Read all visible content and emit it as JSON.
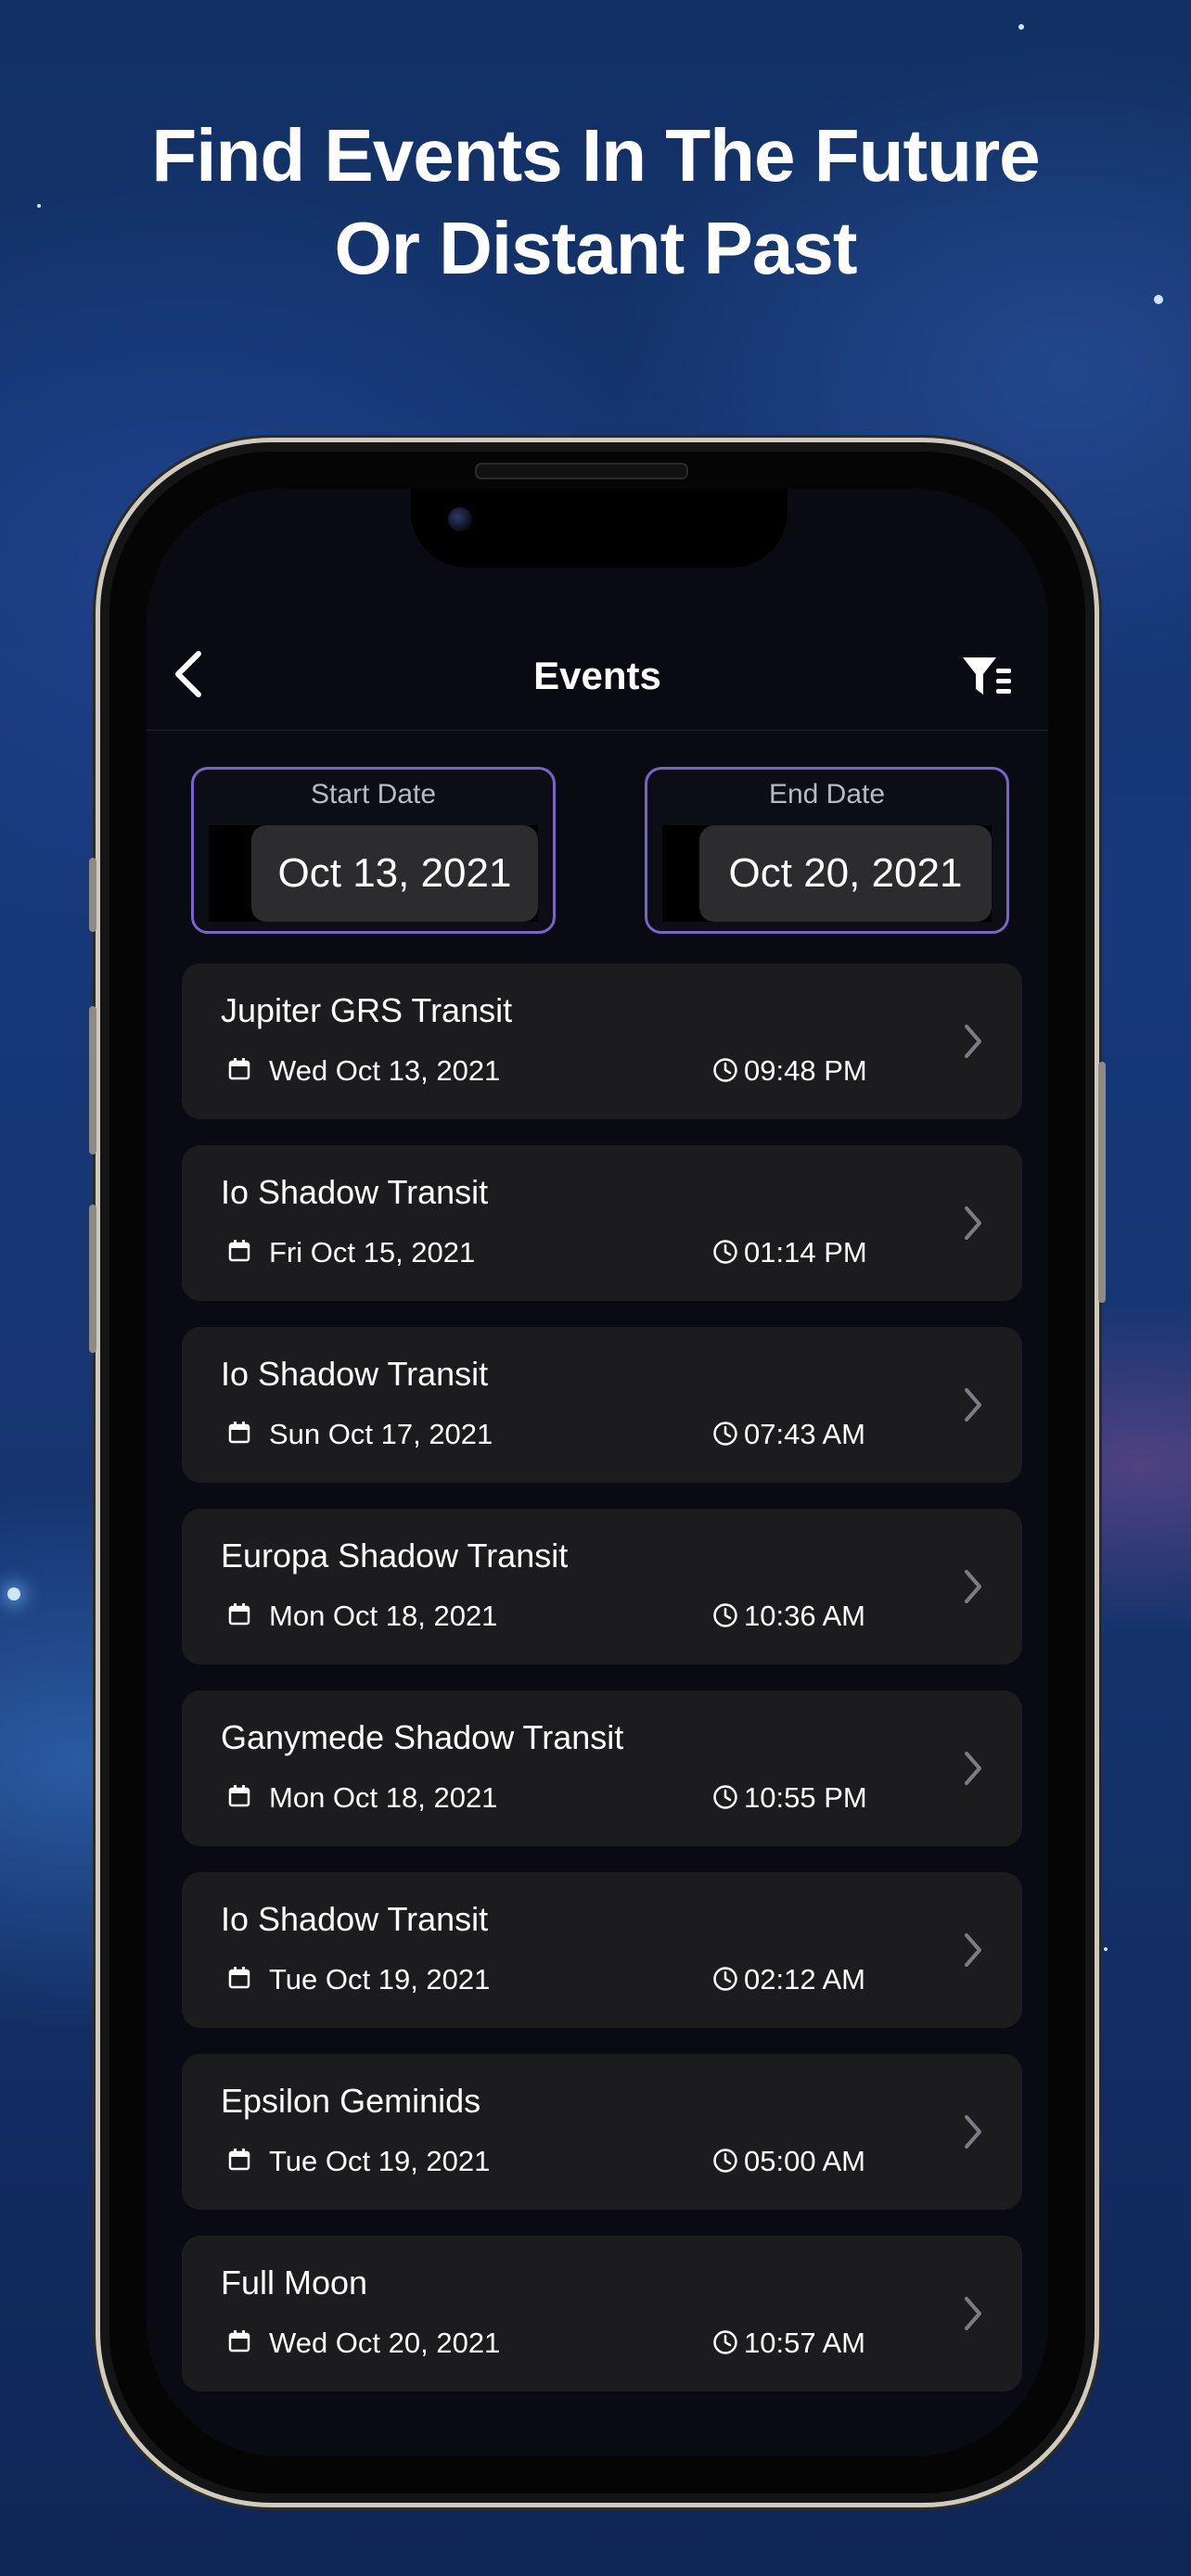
{
  "headline": {
    "line1": "Find Events In The Future",
    "line2": "Or Distant Past"
  },
  "nav": {
    "title": "Events",
    "back_icon": "chevron-left-icon",
    "filter_icon": "filter-list-icon"
  },
  "date_range": {
    "start_label": "Start Date",
    "start_value": "Oct 13, 2021",
    "end_label": "End Date",
    "end_value": "Oct 20, 2021"
  },
  "colors": {
    "accent_border": "#7a63c9",
    "card_bg": "#1c1c1f",
    "screen_bg": "#0a0a12"
  },
  "events": [
    {
      "title": "Jupiter GRS Transit",
      "date": "Wed Oct 13, 2021",
      "time": "09:48 PM"
    },
    {
      "title": "Io Shadow Transit",
      "date": "Fri Oct 15, 2021",
      "time": "01:14 PM"
    },
    {
      "title": "Io Shadow Transit",
      "date": "Sun Oct 17, 2021",
      "time": "07:43 AM"
    },
    {
      "title": "Europa Shadow Transit",
      "date": "Mon Oct 18, 2021",
      "time": "10:36 AM"
    },
    {
      "title": "Ganymede Shadow Transit",
      "date": "Mon Oct 18, 2021",
      "time": "10:55 PM"
    },
    {
      "title": "Io Shadow Transit",
      "date": "Tue Oct 19, 2021",
      "time": "02:12 AM"
    },
    {
      "title": "Epsilon Geminids",
      "date": "Tue Oct 19, 2021",
      "time": "05:00 AM"
    },
    {
      "title": "Full Moon",
      "date": "Wed Oct 20, 2021",
      "time": "10:57 AM"
    }
  ]
}
